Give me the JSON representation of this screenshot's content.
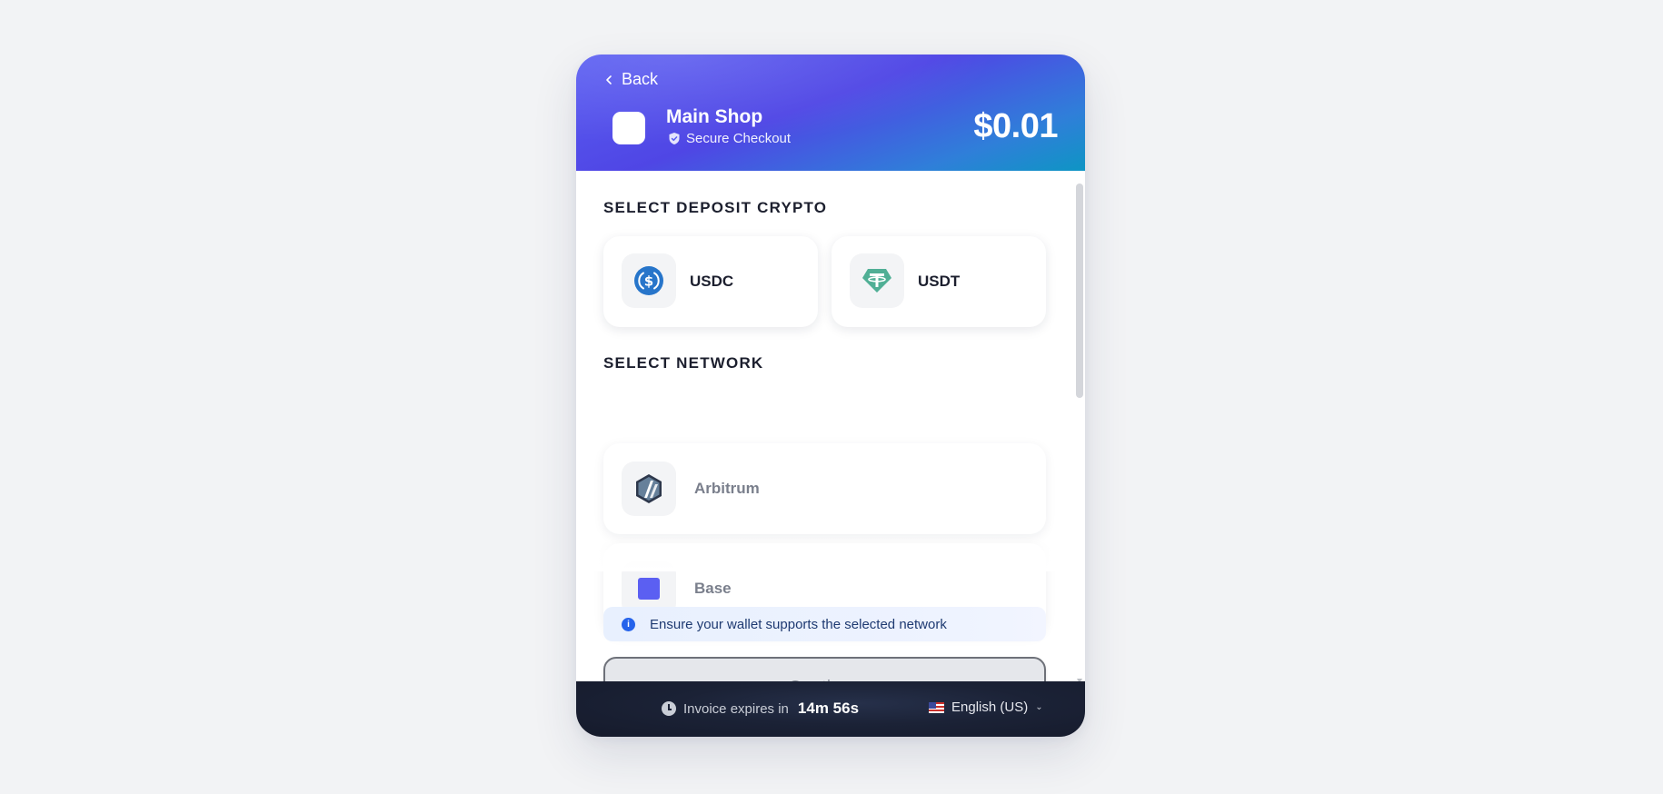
{
  "header": {
    "back_label": "Back",
    "shop_name": "Main Shop",
    "secure_label": "Secure Checkout",
    "amount": "$0.01"
  },
  "crypto_section": {
    "title": "SELECT DEPOSIT CRYPTO",
    "options": [
      {
        "label": "USDC",
        "icon": "usdc-icon",
        "color": "#2775ca"
      },
      {
        "label": "USDT",
        "icon": "tether-icon",
        "color": "#50af95"
      }
    ]
  },
  "network_section": {
    "title": "SELECT NETWORK",
    "options": [
      {
        "label": "Arbitrum",
        "icon": "arbitrum-icon"
      },
      {
        "label": "Base",
        "icon": "base-icon",
        "color": "#5b5ff2"
      }
    ]
  },
  "info": {
    "text": "Ensure your wallet supports the selected network",
    "icon_text": "i"
  },
  "continue_label": "Continue",
  "footer": {
    "expires_label": "Invoice expires in",
    "timer": "14m 56s",
    "language": "English (US)"
  },
  "colors": {
    "header_gradient_start": "#5b5ff2",
    "header_gradient_end": "#0e95c4",
    "footer_bg": "#1b2236"
  }
}
